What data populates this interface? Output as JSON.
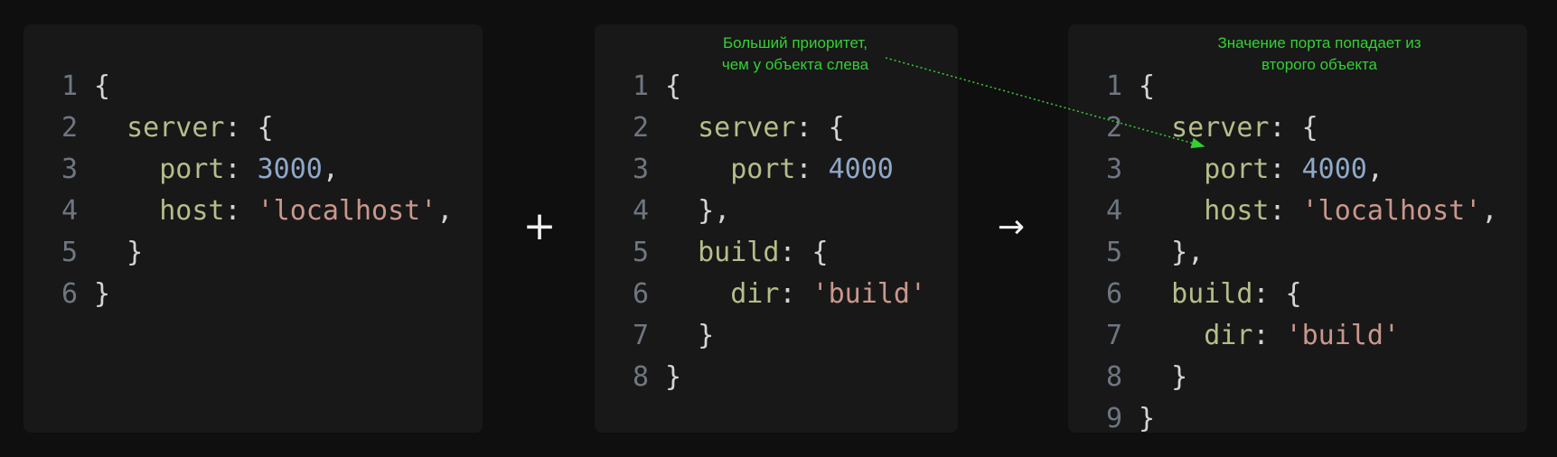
{
  "panels": [
    {
      "lines": [
        {
          "n": "1",
          "tokens": [
            {
              "t": "{",
              "c": "punc"
            }
          ]
        },
        {
          "n": "2",
          "tokens": [
            {
              "t": "  server",
              "c": "key"
            },
            {
              "t": ": {",
              "c": "punc"
            }
          ]
        },
        {
          "n": "3",
          "tokens": [
            {
              "t": "    port",
              "c": "key"
            },
            {
              "t": ": ",
              "c": "punc"
            },
            {
              "t": "3000",
              "c": "num"
            },
            {
              "t": ",",
              "c": "punc"
            }
          ]
        },
        {
          "n": "4",
          "tokens": [
            {
              "t": "    host",
              "c": "key"
            },
            {
              "t": ": ",
              "c": "punc"
            },
            {
              "t": "'localhost'",
              "c": "str"
            },
            {
              "t": ",",
              "c": "punc"
            }
          ]
        },
        {
          "n": "5",
          "tokens": [
            {
              "t": "  }",
              "c": "punc"
            }
          ]
        },
        {
          "n": "6",
          "tokens": [
            {
              "t": "}",
              "c": "punc"
            }
          ]
        }
      ]
    },
    {
      "lines": [
        {
          "n": "1",
          "tokens": [
            {
              "t": "{",
              "c": "punc"
            }
          ]
        },
        {
          "n": "2",
          "tokens": [
            {
              "t": "  server",
              "c": "key"
            },
            {
              "t": ": {",
              "c": "punc"
            }
          ]
        },
        {
          "n": "3",
          "tokens": [
            {
              "t": "    port",
              "c": "key"
            },
            {
              "t": ": ",
              "c": "punc"
            },
            {
              "t": "4000",
              "c": "num"
            }
          ]
        },
        {
          "n": "4",
          "tokens": [
            {
              "t": "  },",
              "c": "punc"
            }
          ]
        },
        {
          "n": "5",
          "tokens": [
            {
              "t": "  build",
              "c": "key"
            },
            {
              "t": ": {",
              "c": "punc"
            }
          ]
        },
        {
          "n": "6",
          "tokens": [
            {
              "t": "    dir",
              "c": "key"
            },
            {
              "t": ": ",
              "c": "punc"
            },
            {
              "t": "'build'",
              "c": "str"
            }
          ]
        },
        {
          "n": "7",
          "tokens": [
            {
              "t": "  }",
              "c": "punc"
            }
          ]
        },
        {
          "n": "8",
          "tokens": [
            {
              "t": "}",
              "c": "punc"
            }
          ]
        }
      ]
    },
    {
      "lines": [
        {
          "n": "1",
          "tokens": [
            {
              "t": "{",
              "c": "punc"
            }
          ]
        },
        {
          "n": "2",
          "tokens": [
            {
              "t": "  server",
              "c": "key"
            },
            {
              "t": ": {",
              "c": "punc"
            }
          ]
        },
        {
          "n": "3",
          "tokens": [
            {
              "t": "    port",
              "c": "key"
            },
            {
              "t": ": ",
              "c": "punc"
            },
            {
              "t": "4000",
              "c": "num"
            },
            {
              "t": ",",
              "c": "punc"
            }
          ]
        },
        {
          "n": "4",
          "tokens": [
            {
              "t": "    host",
              "c": "key"
            },
            {
              "t": ": ",
              "c": "punc"
            },
            {
              "t": "'localhost'",
              "c": "str"
            },
            {
              "t": ",",
              "c": "punc"
            }
          ]
        },
        {
          "n": "5",
          "tokens": [
            {
              "t": "  },",
              "c": "punc"
            }
          ]
        },
        {
          "n": "6",
          "tokens": [
            {
              "t": "  build",
              "c": "key"
            },
            {
              "t": ": {",
              "c": "punc"
            }
          ]
        },
        {
          "n": "7",
          "tokens": [
            {
              "t": "    dir",
              "c": "key"
            },
            {
              "t": ": ",
              "c": "punc"
            },
            {
              "t": "'build'",
              "c": "str"
            }
          ]
        },
        {
          "n": "8",
          "tokens": [
            {
              "t": "  }",
              "c": "punc"
            }
          ]
        },
        {
          "n": "9",
          "tokens": [
            {
              "t": "}",
              "c": "punc"
            }
          ]
        }
      ]
    }
  ],
  "operators": {
    "plus": "+",
    "arrow": "→"
  },
  "notes": {
    "priority": "Больший приоритет,\nчем у объекта слева",
    "port_source": "Значение порта попадает из\nвторого объекта"
  },
  "colors": {
    "annotation": "#33d133",
    "key": "#b5bd8a",
    "number": "#8fa8c8",
    "string": "#c9978c"
  }
}
